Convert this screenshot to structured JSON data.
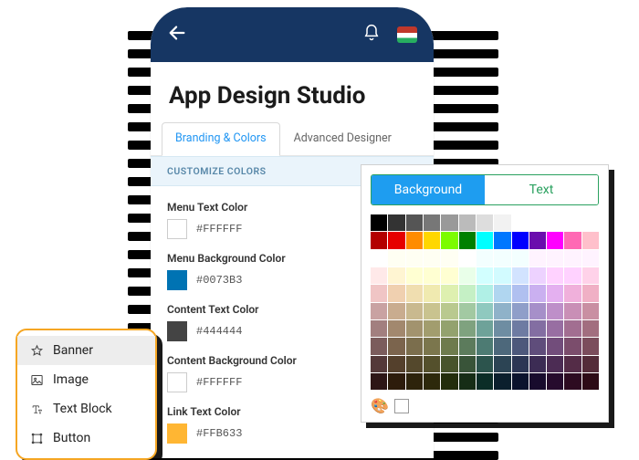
{
  "title": "App Design Studio",
  "tabs": {
    "branding": "Branding & Colors",
    "advanced": "Advanced Designer"
  },
  "section_header": "CUSTOMIZE COLORS",
  "colors": [
    {
      "label": "Menu Text Color",
      "hex": "#FFFFFF"
    },
    {
      "label": "Menu Background Color",
      "hex": "#0073B3"
    },
    {
      "label": "Content Text Color",
      "hex": "#444444"
    },
    {
      "label": "Content Background Color",
      "hex": "#FFFFFF"
    },
    {
      "label": "Link Text Color",
      "hex": "#FFB633"
    }
  ],
  "widgets": [
    "Banner",
    "Image",
    "Text Block",
    "Button"
  ],
  "picker_tabs": {
    "bg": "Background",
    "text": "Text"
  },
  "picker_palette": {
    "accents": [
      "#000000",
      "#333333",
      "#555555",
      "#777777",
      "#999999",
      "#bbbbbb",
      "#dddddd",
      "#f2f2f2",
      "#ffffff"
    ],
    "primaries": [
      "#b30000",
      "#e60000",
      "#ff8c00",
      "#ffd700",
      "#7cfc00",
      "#008000",
      "#00ffff",
      "#0077ff",
      "#0000ff",
      "#6a0dad",
      "#ff00ff",
      "#ff69b4",
      "#ffc0cb"
    ],
    "shade_hues": [
      "#ffcccc",
      "#ffd9b3",
      "#ffe9b3",
      "#fff7b3",
      "#e9ffb3",
      "#ccffcc",
      "#b3fff2",
      "#b3e0ff",
      "#b3c6ff",
      "#d1b3ff",
      "#f0b3ff",
      "#ffb3e6",
      "#ffb3cc"
    ],
    "shade_steps": 8
  }
}
